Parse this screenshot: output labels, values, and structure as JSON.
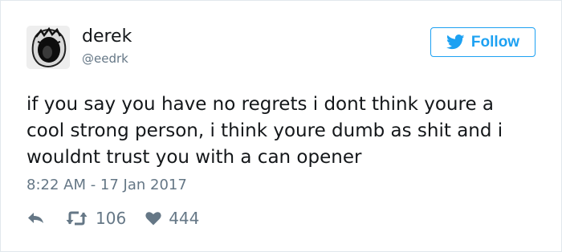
{
  "user": {
    "name": "derek",
    "handle": "@eedrk",
    "avatar_icon": "screaming-face-avatar"
  },
  "follow_button": {
    "label": "Follow",
    "icon": "twitter-bird-icon",
    "accent_color": "#1da1f2"
  },
  "tweet": {
    "lines": [
      "if you say you have no regrets i dont think youre a",
      "cool strong person, i think youre dumb as shit and i",
      "wouldnt trust you with a can opener"
    ],
    "timestamp": "8:22 AM - 17 Jan 2017"
  },
  "actions": {
    "reply_icon": "reply-arrow-icon",
    "retweet_icon": "retweet-icon",
    "retweet_count": "106",
    "like_icon": "heart-icon",
    "like_count": "444"
  },
  "colors": {
    "text": "#14171a",
    "muted": "#657786",
    "border": "#e1e8ed"
  }
}
